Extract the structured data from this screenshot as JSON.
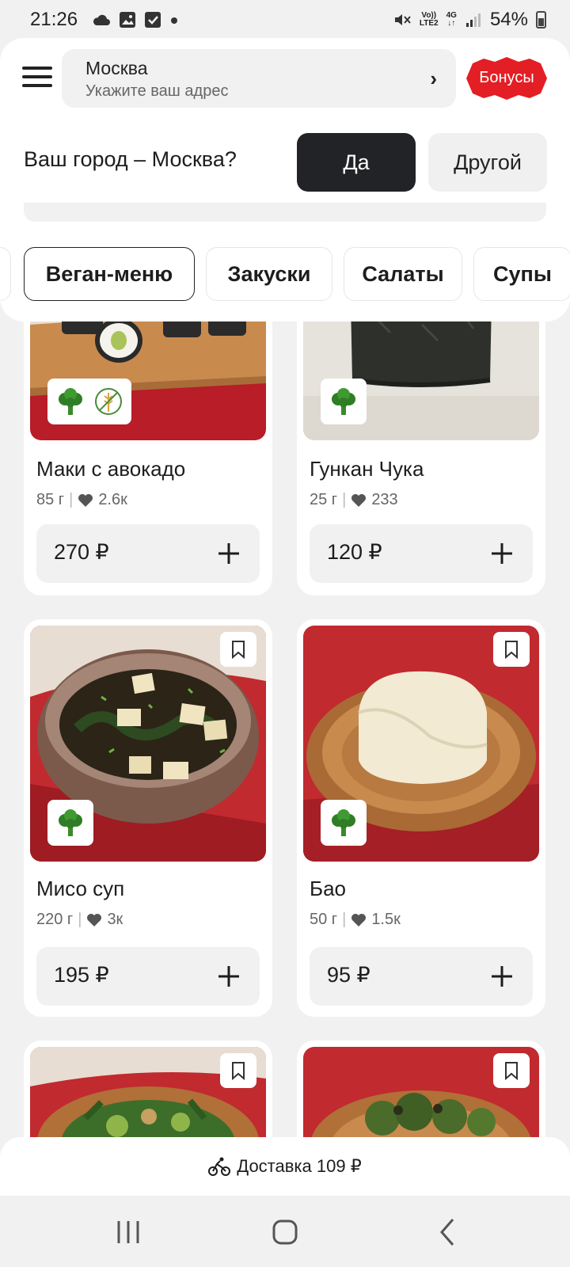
{
  "status_bar": {
    "time": "21:26",
    "left_icons": [
      "cloud-icon",
      "image-icon",
      "checkbox-icon",
      "dot-icon"
    ],
    "network_top": "Vo))",
    "network_bottom": "LTE2",
    "network_type": "4G",
    "battery": "54%"
  },
  "header": {
    "city": "Москва",
    "address_hint": "Укажите ваш адрес",
    "bonus_label": "Бонусы",
    "city_question": "Ваш город – Москва?",
    "yes_label": "Да",
    "other_label": "Другой"
  },
  "categories": [
    {
      "label": "Веган-меню",
      "active": true
    },
    {
      "label": "Закуски",
      "active": false
    },
    {
      "label": "Салаты",
      "active": false
    },
    {
      "label": "Супы",
      "active": false
    }
  ],
  "products": [
    {
      "name": "Маки с авокадо",
      "weight": "85 г",
      "likes": "2.6к",
      "price": "270 ₽",
      "badges": [
        "vegan-icon",
        "gluten-free-icon"
      ]
    },
    {
      "name": "Гункан Чука",
      "weight": "25 г",
      "likes": "233",
      "price": "120 ₽",
      "badges": [
        "vegan-icon"
      ]
    },
    {
      "name": "Мисо суп",
      "weight": "220 г",
      "likes": "3к",
      "price": "195 ₽",
      "badges": [
        "vegan-icon"
      ]
    },
    {
      "name": "Бао",
      "weight": "50 г",
      "likes": "1.5к",
      "price": "95 ₽",
      "badges": [
        "vegan-icon"
      ]
    }
  ],
  "delivery": {
    "label": "Доставка 109 ₽"
  },
  "colors": {
    "brand_red": "#e31e24",
    "dark_button": "#222326",
    "background": "#f1f1f2"
  }
}
